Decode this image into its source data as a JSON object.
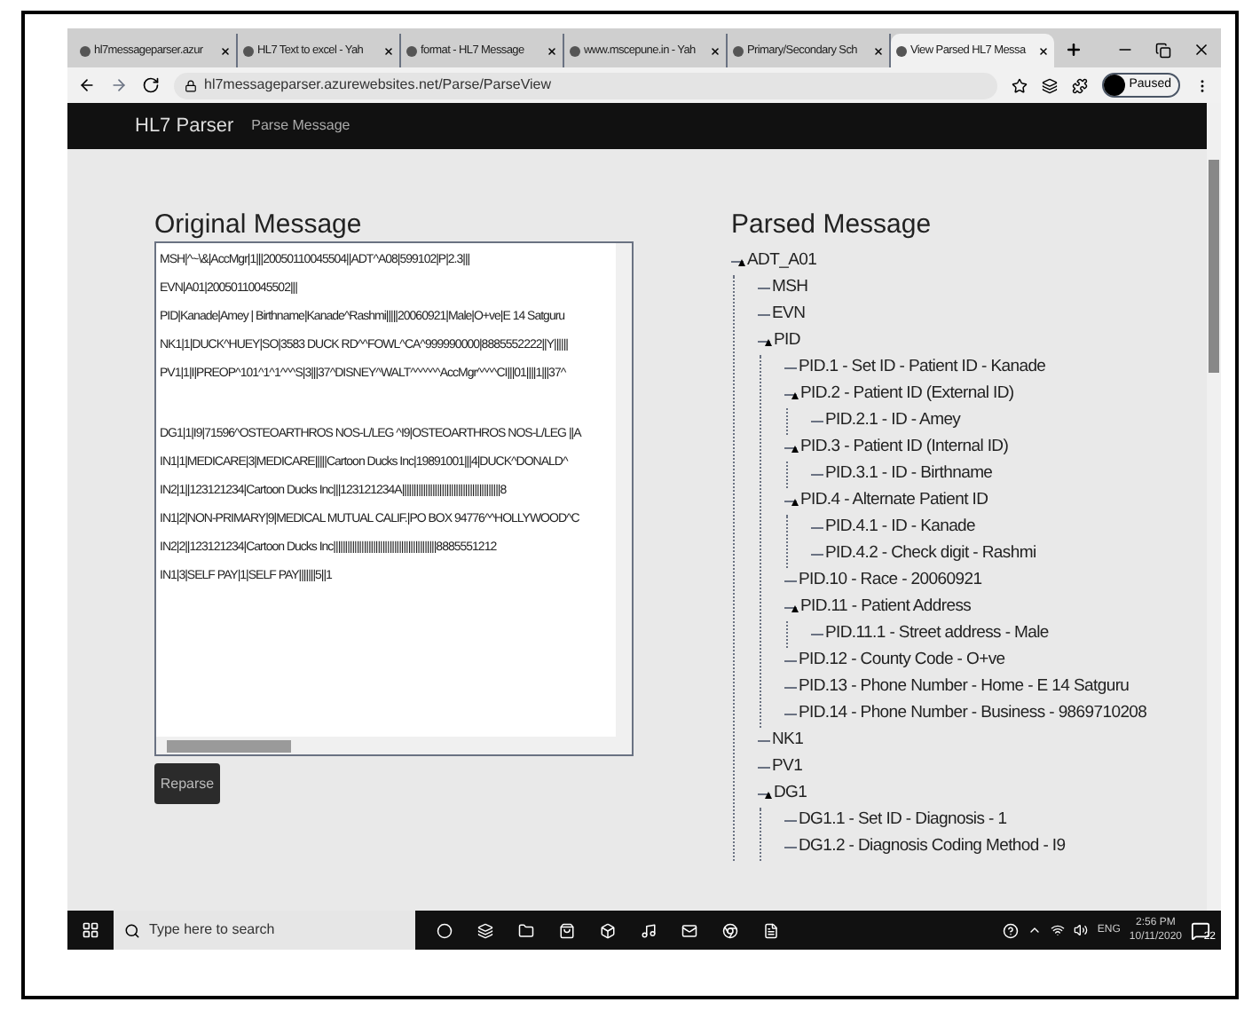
{
  "browser": {
    "tabs": [
      {
        "title": "hl7messageparser.azur",
        "selected": false
      },
      {
        "title": "HL7 Text to excel - Yah",
        "selected": false
      },
      {
        "title": "format - HL7 Message",
        "selected": false
      },
      {
        "title": "www.mscepune.in - Yah",
        "selected": false
      },
      {
        "title": "Primary/Secondary Sch",
        "selected": false
      },
      {
        "title": "View Parsed HL7 Messa",
        "selected": true
      }
    ],
    "address": "hl7messageparser.azurewebsites.net/Parse/ParseView",
    "profile": "Paused"
  },
  "navbar": {
    "brand": "HL7 Parser",
    "links": [
      "Parse Message"
    ]
  },
  "original": {
    "title": "Original Message",
    "blocks": [
      [
        "MSH|^~\\&|AccMgr|1|||20050110045504||ADT^A08|599102|P|2.3|||",
        "EVN|A01|20050110045502|||",
        "PID|Kanade|Amey | Birthname|Kanade^Rashmi|||||20060921|Male|O+ve|E 14 Satguru",
        "NK1|1|DUCK^HUEY|SO|3583 DUCK RD^^FOWL^CA^999990000|8885552222||Y||||||",
        "PV1|1|I|PREOP^101^1^1^^^S|3|||37^DISNEY^WALT^^^^^^AccMgr^^^^CI|||01||||1|||37^"
      ],
      [
        "DG1|1|I9|71596^OSTEOARTHROS NOS-L/LEG ^I9|OSTEOARTHROS NOS-L/LEG ||A",
        "IN1|1|MEDICARE|3|MEDICARE|||||Cartoon Ducks Inc|19891001|||4|DUCK^DONALD^",
        "IN2|1||123121234|Cartoon Ducks Inc|||123121234A||||||||||||||||||||||||||||||||||||||||||8",
        "IN1|2|NON-PRIMARY|9|MEDICAL MUTUAL CALIF.|PO BOX 94776^^HOLLYWOOD^C",
        "IN2|2||123121234|Cartoon Ducks Inc||||||||||||||||||||||||||||||||||||||||||||8885551212",
        "IN1|3|SELF PAY|1|SELF PAY|||||||5||1"
      ]
    ],
    "button": "Reparse"
  },
  "parsed": {
    "title": "Parsed Message",
    "tree": [
      {
        "label": "ADT_A01",
        "children": [
          {
            "label": "MSH"
          },
          {
            "label": "EVN"
          },
          {
            "label": "PID",
            "children": [
              {
                "label": "PID.1 - Set ID - Patient ID - Kanade"
              },
              {
                "label": "PID.2 - Patient ID (External ID)",
                "children": [
                  {
                    "label": "PID.2.1 - ID - Amey"
                  }
                ]
              },
              {
                "label": "PID.3 - Patient ID (Internal ID)",
                "children": [
                  {
                    "label": "PID.3.1 - ID - Birthname"
                  }
                ]
              },
              {
                "label": "PID.4 - Alternate Patient ID",
                "children": [
                  {
                    "label": "PID.4.1 - ID - Kanade"
                  },
                  {
                    "label": "PID.4.2 - Check digit - Rashmi"
                  }
                ]
              },
              {
                "label": "PID.10 - Race - 20060921"
              },
              {
                "label": "PID.11 - Patient Address",
                "children": [
                  {
                    "label": "PID.11.1 - Street address - Male"
                  }
                ]
              },
              {
                "label": "PID.12 - County Code - O+ve"
              },
              {
                "label": "PID.13 - Phone Number - Home - E 14 Satguru"
              },
              {
                "label": "PID.14 - Phone Number - Business - 9869710208"
              }
            ]
          },
          {
            "label": "NK1"
          },
          {
            "label": "PV1"
          },
          {
            "label": "DG1",
            "children": [
              {
                "label": "DG1.1 - Set ID - Diagnosis - 1"
              },
              {
                "label": "DG1.2 - Diagnosis Coding Method - I9"
              }
            ]
          }
        ]
      }
    ]
  },
  "taskbar": {
    "search_placeholder": "Type here to search",
    "language": "ENG",
    "time": "2:56 PM",
    "date": "10/11/2020",
    "notifications": "22"
  }
}
